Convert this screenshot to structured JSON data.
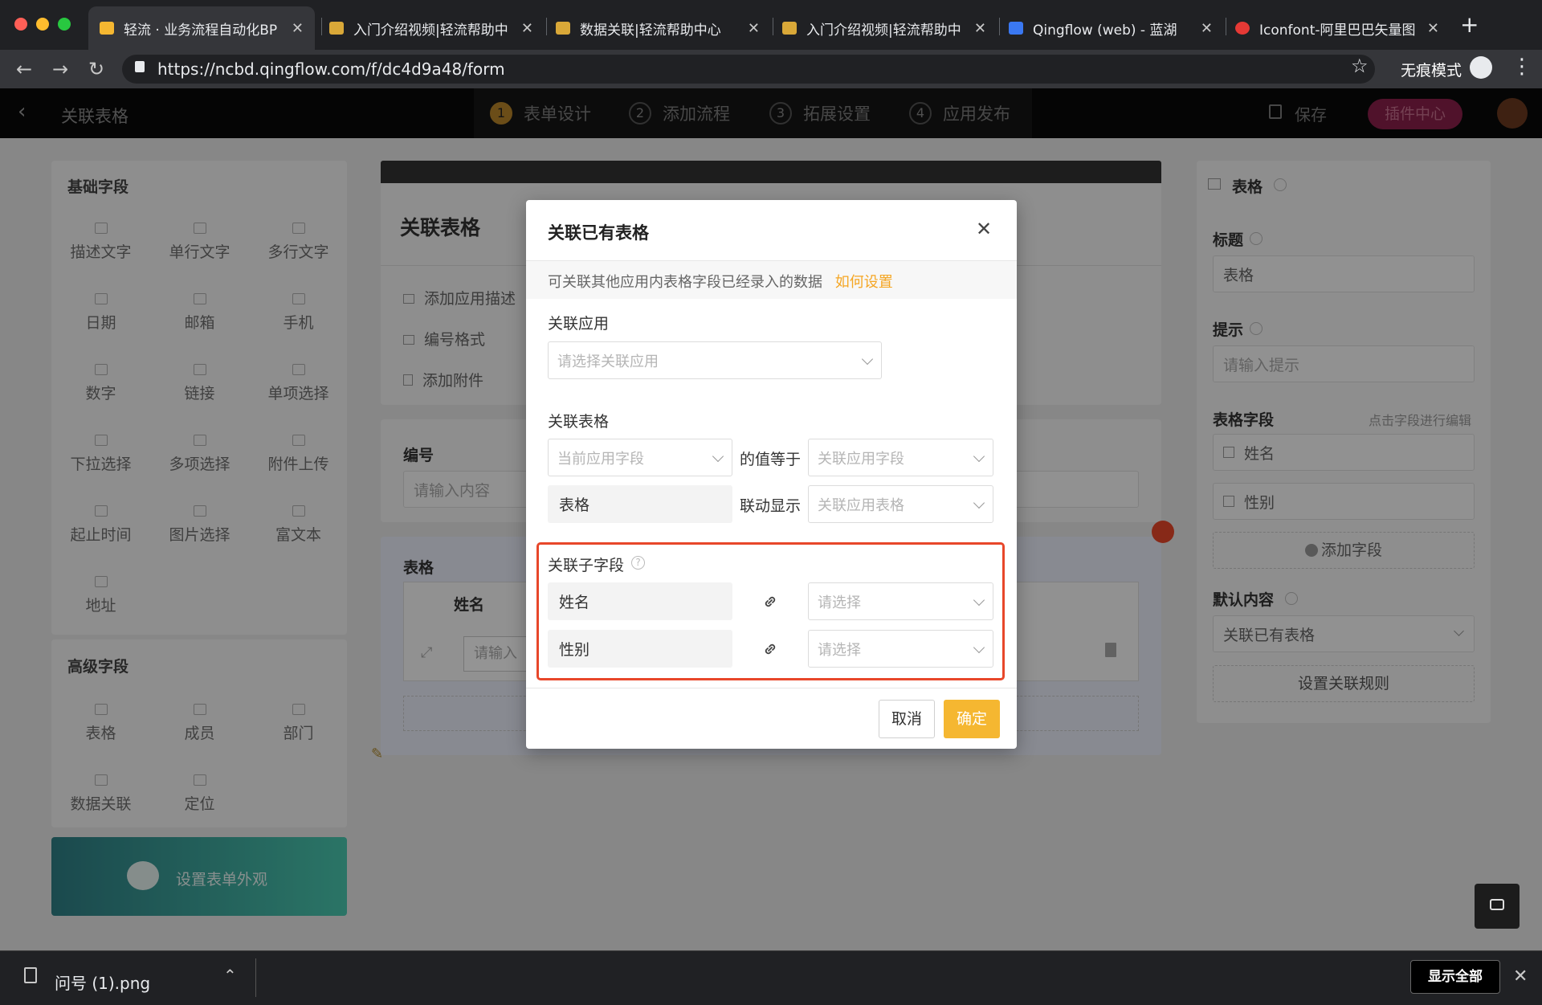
{
  "browser": {
    "tabs": [
      {
        "title": "轻流 · 业务流程自动化BP",
        "active": true
      },
      {
        "title": "入门介绍视频|轻流帮助中"
      },
      {
        "title": "数据关联|轻流帮助中心"
      },
      {
        "title": "入门介绍视频|轻流帮助中"
      },
      {
        "title": "Qingflow (web) - 蓝湖"
      },
      {
        "title": "Iconfont-阿里巴巴矢量图"
      }
    ],
    "url": "https://ncbd.qingflow.com/f/dc4d9a48/form",
    "profile_label": "无痕模式"
  },
  "header": {
    "page_title": "关联表格",
    "steps": [
      {
        "num": "1",
        "label": "表单设计"
      },
      {
        "num": "2",
        "label": "添加流程"
      },
      {
        "num": "3",
        "label": "拓展设置"
      },
      {
        "num": "4",
        "label": "应用发布"
      }
    ],
    "save_label": "保存",
    "plugin_label": "插件中心"
  },
  "left_panel": {
    "basic_title": "基础字段",
    "basic_fields": [
      "描述文字",
      "单行文字",
      "多行文字",
      "日期",
      "邮箱",
      "手机",
      "数字",
      "链接",
      "单项选择",
      "下拉选择",
      "多项选择",
      "附件上传",
      "起止时间",
      "图片选择",
      "富文本",
      "地址"
    ],
    "advanced_title": "高级字段",
    "advanced_fields": [
      "表格",
      "成员",
      "部门",
      "数据关联",
      "定位"
    ],
    "appearance_button": "设置表单外观"
  },
  "canvas": {
    "form_title": "关联表格",
    "actions": [
      "添加应用描述",
      "编号格式",
      "添加附件"
    ],
    "number_label": "编号",
    "number_placeholder": "请输入内容",
    "table_label": "表格",
    "table_col_name": "姓名",
    "table_cell_placeholder": "请输入"
  },
  "right_panel": {
    "header": "表格",
    "title_label": "标题",
    "title_value": "表格",
    "hint_label": "提示",
    "hint_placeholder": "请输入提示",
    "fields_label": "表格字段",
    "fields_hint": "点击字段进行编辑",
    "fields": [
      "姓名",
      "性别"
    ],
    "add_field": "添加字段",
    "default_label": "默认内容",
    "default_value": "关联已有表格",
    "rule_button": "设置关联规则"
  },
  "modal": {
    "title": "关联已有表格",
    "notice": "可关联其他应用内表格字段已经录入的数据",
    "notice_link": "如何设置",
    "app_label": "关联应用",
    "app_placeholder": "请选择关联应用",
    "table_label": "关联表格",
    "cur_field_placeholder": "当前应用字段",
    "equals_text": "的值等于",
    "rel_field_placeholder": "关联应用字段",
    "table_static": "表格",
    "linked_display_text": "联动显示",
    "rel_table_placeholder": "关联应用表格",
    "subfield_label": "关联子字段",
    "subfields": [
      {
        "name": "姓名",
        "placeholder": "请选择"
      },
      {
        "name": "性别",
        "placeholder": "请选择"
      }
    ],
    "cancel_label": "取消",
    "ok_label": "确定",
    "highlight_color": "#e8472a",
    "accent_color": "#f5b731"
  },
  "download_bar": {
    "file_name": "问号 (1).png",
    "show_all": "显示全部"
  }
}
